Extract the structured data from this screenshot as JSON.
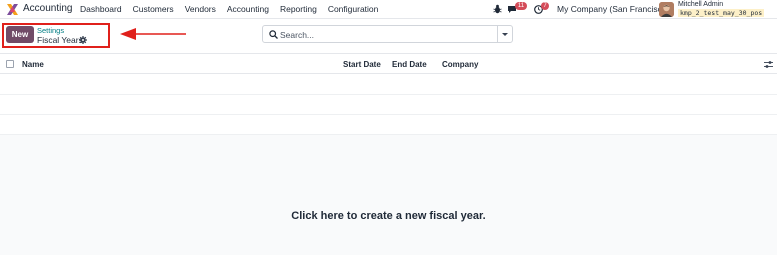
{
  "navbar": {
    "app_name": "Accounting",
    "menu": [
      "Dashboard",
      "Customers",
      "Vendors",
      "Accounting",
      "Reporting",
      "Configuration"
    ],
    "chat_count": "11",
    "activity_count": "7",
    "company": "My Company (San Francisco)",
    "user_name": "Mitchell Admin",
    "db_name": "kmp_2_test_may_30_pos",
    "icons": [
      "bug-icon",
      "chat-icon",
      "clock-icon"
    ]
  },
  "control_panel": {
    "new_label": "New",
    "breadcrumb_parent": "Settings",
    "breadcrumb_current": "Fiscal Years",
    "search_placeholder": "Search...",
    "annotation_color": "#e0201b"
  },
  "list": {
    "columns": [
      "Name",
      "Start Date",
      "End Date",
      "Company"
    ],
    "help_message": "Click here to create a new fiscal year."
  },
  "colors": {
    "primary": "#714b67",
    "link": "#017e84",
    "badge": "#d44c59"
  }
}
